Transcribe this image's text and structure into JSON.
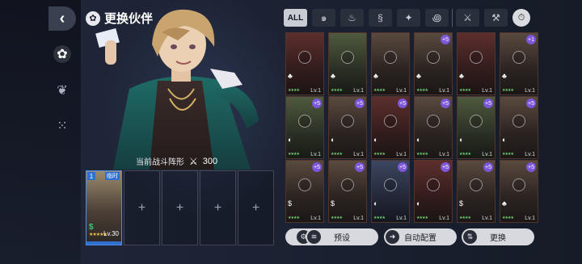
{
  "title": "更换伙伴",
  "formation": {
    "label": "当前战斗阵形",
    "power": "300"
  },
  "slot1": {
    "number": "1",
    "badge": "临时",
    "stars": "★★★★★",
    "level": "Lv.30",
    "money": "$"
  },
  "slot_empty": "+",
  "filters": {
    "all": "ALL",
    "icons": [
      "wind-icon",
      "fire-icon",
      "water-icon",
      "star-icon",
      "vortex-icon",
      "sword-icon",
      "hammer-icon",
      "clock-icon"
    ]
  },
  "cards": [
    {
      "level": "Lv.1",
      "tone": "red",
      "plus": "",
      "elem": "♣"
    },
    {
      "level": "Lv.1",
      "tone": "green",
      "plus": "",
      "elem": "♣"
    },
    {
      "level": "Lv.1",
      "tone": "",
      "plus": "",
      "elem": "♣"
    },
    {
      "level": "Lv.1",
      "tone": "",
      "plus": "+5",
      "elem": "♣"
    },
    {
      "level": "Lv.1",
      "tone": "red",
      "plus": "",
      "elem": "♣"
    },
    {
      "level": "Lv.1",
      "tone": "",
      "plus": "+1",
      "elem": "♣"
    },
    {
      "level": "Lv.1",
      "tone": "green",
      "plus": "+5",
      "elem": "◐"
    },
    {
      "level": "Lv.1",
      "tone": "",
      "plus": "+5",
      "elem": "◐"
    },
    {
      "level": "Lv.1",
      "tone": "red",
      "plus": "+5",
      "elem": "◐"
    },
    {
      "level": "Lv.1",
      "tone": "",
      "plus": "+5",
      "elem": "◐"
    },
    {
      "level": "Lv.1",
      "tone": "green",
      "plus": "+5",
      "elem": "◐"
    },
    {
      "level": "Lv.1",
      "tone": "",
      "plus": "+5",
      "elem": "◐"
    },
    {
      "level": "Lv.1",
      "tone": "",
      "plus": "+5",
      "elem": "$"
    },
    {
      "level": "Lv.1",
      "tone": "",
      "plus": "+5",
      "elem": "$"
    },
    {
      "level": "Lv.1",
      "tone": "blue",
      "plus": "+5",
      "elem": "◐"
    },
    {
      "level": "Lv.1",
      "tone": "red",
      "plus": "+5",
      "elem": "◐"
    },
    {
      "level": "Lv.1",
      "tone": "",
      "plus": "+5",
      "elem": "$"
    },
    {
      "level": "Lv.1",
      "tone": "",
      "plus": "+5",
      "elem": "♣"
    }
  ],
  "buttons": {
    "preset": "预设",
    "auto": "自动配置",
    "swap": "更换"
  }
}
